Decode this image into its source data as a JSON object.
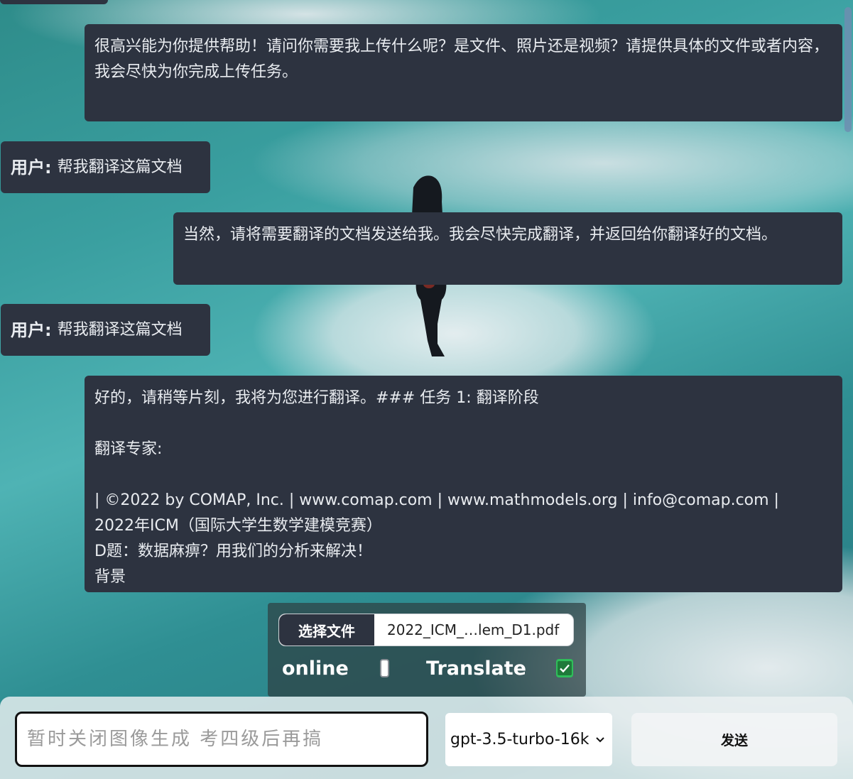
{
  "chat": {
    "messages": [
      {
        "role": "assistant",
        "text": "很高兴能为你提供帮助！请问你需要我上传什么呢？是文件、照片还是视频？请提供具体的文件或者内容，我会尽快为你完成上传任务。"
      },
      {
        "role": "user",
        "prefix": "用户:",
        "text": "帮我翻译这篇文档"
      },
      {
        "role": "assistant",
        "text": "当然，请将需要翻译的文档发送给我。我会尽快完成翻译，并返回给你翻译好的文档。"
      },
      {
        "role": "user",
        "prefix": "用户:",
        "text": "帮我翻译这篇文档"
      },
      {
        "role": "assistant",
        "text": "好的，请稍等片刻，我将为您进行翻译。### 任务 1: 翻译阶段\n\n翻译专家:\n\n| ©2022 by COMAP, Inc. | www.comap.com | www.mathmodels.org | info@comap.com |\n2022年ICM（国际大学生数学建模竞赛）\nD题：数据麻痹？用我们的分析来解决！\n背景"
      }
    ]
  },
  "upload": {
    "button_label": "选择文件",
    "file_name": "2022_ICM_…lem_D1.pdf"
  },
  "toggles": {
    "online_label": "online",
    "online_checked": false,
    "translate_label": "Translate",
    "translate_checked": true
  },
  "composer": {
    "placeholder": "暂时关闭图像生成 考四级后再搞",
    "model_selected": "gpt-3.5-turbo-16k",
    "send_label": "发送"
  },
  "colors": {
    "bubble_bg": "#2d3340",
    "bubble_text": "#e9ecf0",
    "check_green": "#2fbe5a"
  }
}
